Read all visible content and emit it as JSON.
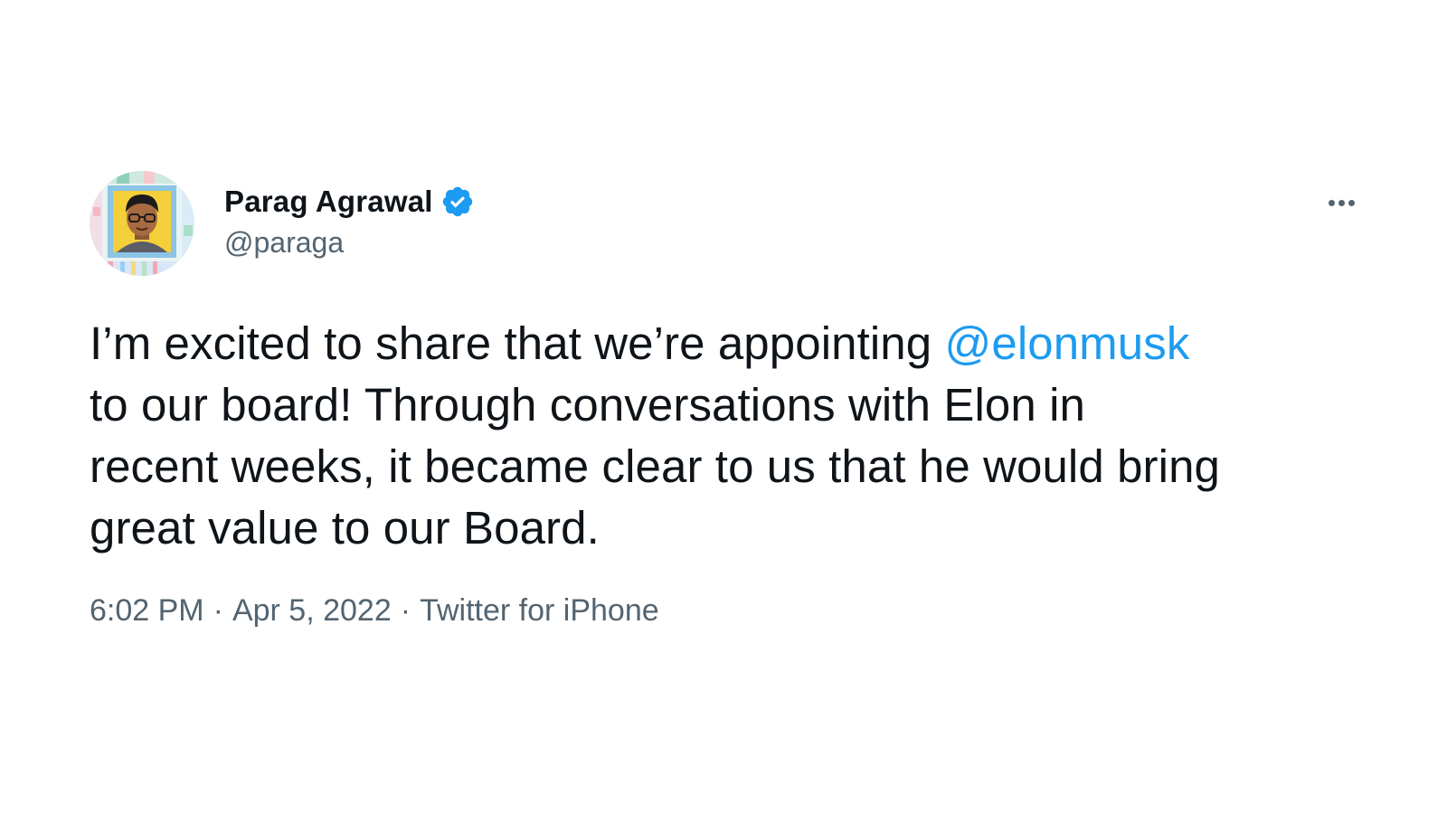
{
  "colors": {
    "text_primary": "#0f1419",
    "text_secondary": "#536471",
    "link": "#1d9bf0",
    "verified": "#1d9bf0",
    "background": "#ffffff"
  },
  "author": {
    "display_name": "Parag Agrawal",
    "handle": "@paraga",
    "verified_icon": "verified-badge-icon",
    "avatar_icon": "avatar-illustration"
  },
  "more_icon": "more-options-icon",
  "tweet": {
    "lines": [
      {
        "before": "I’m excited to share that we’re appointing ",
        "mention": "@elonmusk",
        "after": ""
      },
      {
        "before": "to our board! Through conversations with Elon in",
        "mention": "",
        "after": ""
      },
      {
        "before": "recent weeks, it became clear to us that he would bring",
        "mention": "",
        "after": ""
      },
      {
        "before": "great value to our Board.",
        "mention": "",
        "after": ""
      }
    ]
  },
  "meta": {
    "time": "6:02 PM",
    "separator": "·",
    "date": "Apr 5, 2022",
    "source": "Twitter for iPhone"
  }
}
